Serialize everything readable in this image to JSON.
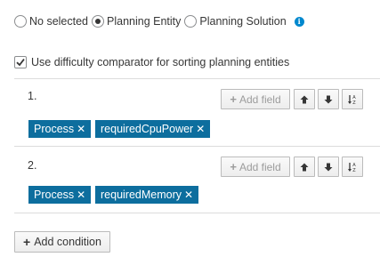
{
  "entity_type": {
    "options": [
      {
        "label": "No selected",
        "checked": false
      },
      {
        "label": "Planning Entity",
        "checked": true
      },
      {
        "label": "Planning Solution",
        "checked": false
      }
    ],
    "info_icon": "info-icon"
  },
  "difficulty": {
    "label": "Use difficulty comparator for sorting planning entities",
    "checked": true
  },
  "conditions": [
    {
      "number": "1.",
      "add_field_label": "Add field",
      "tags": [
        {
          "label": "Process",
          "remove": "✕"
        },
        {
          "label": "requiredCpuPower",
          "remove": "✕"
        }
      ]
    },
    {
      "number": "2.",
      "add_field_label": "Add field",
      "tags": [
        {
          "label": "Process",
          "remove": "✕"
        },
        {
          "label": "requiredMemory",
          "remove": "✕"
        }
      ]
    }
  ],
  "icons": {
    "move_up": "arrow-up-icon",
    "move_down": "arrow-down-icon",
    "sort": "sort-ascending-icon"
  },
  "add_condition_label": "Add condition",
  "colors": {
    "tag_bg": "#0d6e9e",
    "info": "#0088ce"
  }
}
